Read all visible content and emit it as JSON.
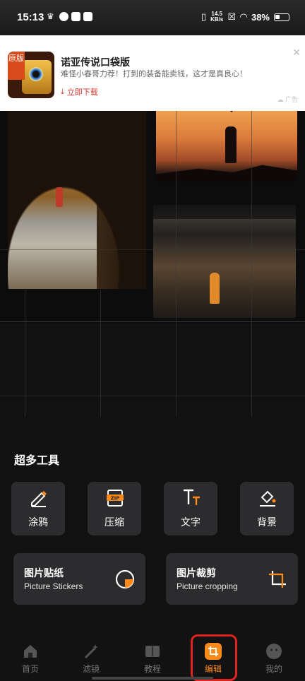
{
  "status_bar": {
    "time": "15:13",
    "net_speed_value": "14.5",
    "net_speed_unit": "KB/s",
    "battery": "38%"
  },
  "ad": {
    "logo_text": "原版",
    "title": "诺亚传说口袋版",
    "description": "难怪小春哥力荐！打到的装备能卖钱，这才是真良心！",
    "cta": "立即下载",
    "tag": "广告"
  },
  "tools": {
    "section_title": "超多工具",
    "items": [
      {
        "label": "涂鸦",
        "icon": "pencil-icon"
      },
      {
        "label": "压缩",
        "icon": "zip-icon"
      },
      {
        "label": "文字",
        "icon": "text-icon"
      },
      {
        "label": "背景",
        "icon": "paint-bucket-icon"
      }
    ],
    "wide": [
      {
        "title": "图片贴纸",
        "subtitle": "Picture Stickers",
        "icon": "sticker-icon"
      },
      {
        "title": "图片裁剪",
        "subtitle": "Picture cropping",
        "icon": "crop-icon"
      }
    ]
  },
  "bottom_nav": {
    "items": [
      {
        "label": "首页",
        "icon": "home-icon"
      },
      {
        "label": "滤镜",
        "icon": "magic-wand-icon"
      },
      {
        "label": "教程",
        "icon": "book-icon"
      },
      {
        "label": "编辑",
        "icon": "edit-crop-icon",
        "active": true
      },
      {
        "label": "我的",
        "icon": "face-icon"
      }
    ]
  },
  "colors": {
    "accent": "#ff8a1a",
    "card": "#2c2c2e",
    "background": "#111111",
    "highlight": "#e0231f"
  }
}
